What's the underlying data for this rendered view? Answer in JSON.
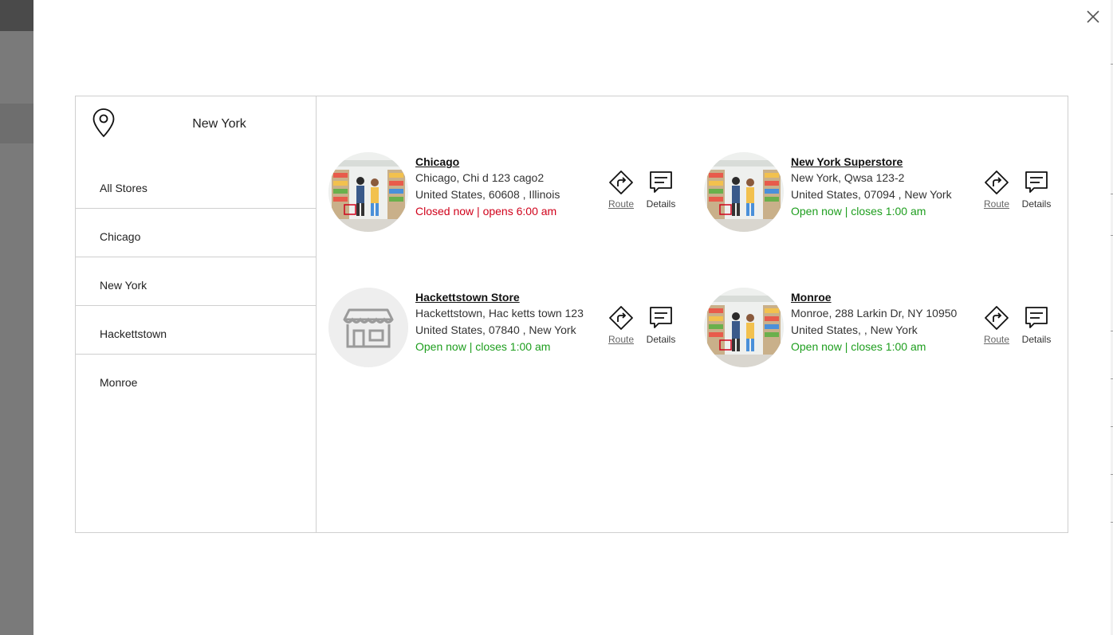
{
  "modal": {
    "close_label": "close-icon"
  },
  "location": {
    "current": "New York",
    "icon": "map-pin-icon"
  },
  "filters": [
    {
      "label": "All Stores"
    },
    {
      "label": "Chicago"
    },
    {
      "label": "New York"
    },
    {
      "label": "Hackettstown"
    },
    {
      "label": "Monroe"
    }
  ],
  "actions": {
    "route_label": "Route",
    "details_label": "Details"
  },
  "stores": [
    {
      "name": "Chicago",
      "address_line1": "Chicago, Chi d 123 cago2",
      "address_line2": "United States, 60608 , Illinois",
      "status": "Closed now | opens 6:00 am",
      "status_type": "closed",
      "image": "store-interior-image"
    },
    {
      "name": "New York Superstore",
      "address_line1": "New York, Qwsa 123-2",
      "address_line2": "United States, 07094 , New York",
      "status": "Open now | closes 1:00 am",
      "status_type": "open",
      "image": "store-interior-image"
    },
    {
      "name": "Hackettstown Store",
      "address_line1": "Hackettstown, Hac ketts town 123",
      "address_line2": "United States, 07840 , New York",
      "status": "Open now | closes 1:00 am",
      "status_type": "open",
      "image": "storefront-placeholder-icon"
    },
    {
      "name": "Monroe",
      "address_line1": "Monroe, 288 Larkin Dr, NY 10950",
      "address_line2": "United States, , New York",
      "status": "Open now | closes 1:00 am",
      "status_type": "open",
      "image": "store-interior-image"
    }
  ],
  "colors": {
    "closed": "#d0021b",
    "open": "#1e9e1e",
    "border": "#cfcfcf",
    "overlay": "#7a7a7a"
  }
}
